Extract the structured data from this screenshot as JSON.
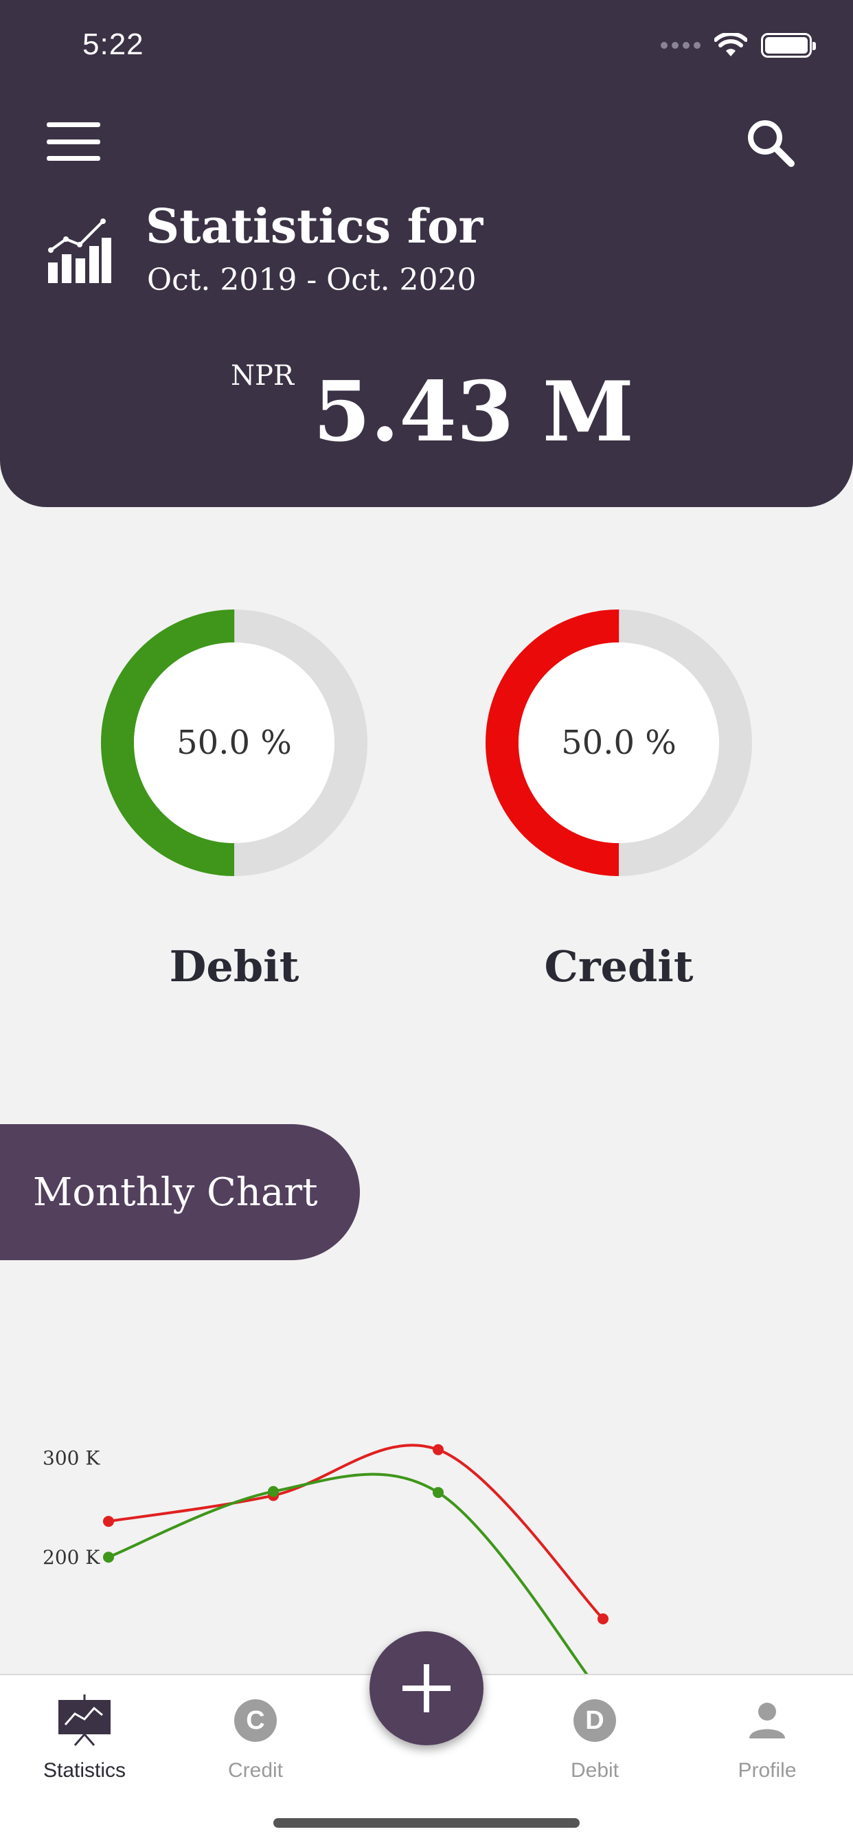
{
  "status_bar": {
    "time": "5:22"
  },
  "header": {
    "title": "Statistics for",
    "period": "Oct. 2019 - Oct. 2020",
    "currency": "NPR",
    "total": "5.43 M",
    "icons": {
      "menu": "hamburger-menu-icon",
      "search": "search-icon",
      "stats": "bar-chart-trend-icon"
    }
  },
  "donuts": [
    {
      "label": "Debit",
      "percent_text": "50.0 %",
      "fraction": 0.5,
      "color": "#3f961a"
    },
    {
      "label": "Credit",
      "percent_text": "50.0 %",
      "fraction": 0.5,
      "color": "#ea0a0a"
    }
  ],
  "monthly_chart_label": "Monthly Chart",
  "chart_data": {
    "type": "line",
    "x": [
      1,
      2,
      3,
      4
    ],
    "yticks": [
      "300 K",
      "200 K"
    ],
    "ylim": [
      80000,
      370000
    ],
    "series": [
      {
        "values": [
          236000,
          262000,
          308000,
          138000
        ],
        "color": "#e02020"
      },
      {
        "values": [
          200000,
          266000,
          265000,
          60000
        ],
        "color": "#3f961a"
      }
    ]
  },
  "bottom_nav": {
    "items": [
      {
        "label": "Statistics",
        "icon": "presentation-chart-icon",
        "active": true
      },
      {
        "label": "Credit",
        "icon": "C",
        "active": false
      },
      {
        "label": "Debit",
        "icon": "D",
        "active": false
      },
      {
        "label": "Profile",
        "icon": "person-icon",
        "active": false
      }
    ],
    "fab_icon": "plus-icon"
  }
}
